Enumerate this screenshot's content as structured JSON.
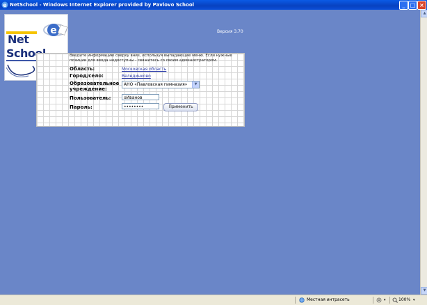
{
  "window": {
    "title": "NetSchool - Windows Internet Explorer provided by Pavlovo School",
    "buttons": {
      "minimize": "_",
      "maximize": "□",
      "close": "×"
    }
  },
  "header": {
    "version": "Версия 3.70",
    "logo": {
      "line1": "Net",
      "line2": "School"
    }
  },
  "login": {
    "intro": "Введите информацию сверху вниз, используя выпадающие меню. Если нужные позиции для ввода недоступны - свяжитесь со своим администратором.",
    "region_label": "Область:",
    "region_value": "Московская область",
    "city_label": "Город/село:",
    "city_value": "Велединково",
    "school_label": "Образовательное учреждение:",
    "school_value": "АНО «Павловская гимназия»",
    "user_label": "Пользователь:",
    "user_value": "оИванов",
    "password_label": "Пароль:",
    "password_value": "••••••••",
    "apply_label": "Применить"
  },
  "statusbar": {
    "zone": "Местная интрасеть",
    "zoom": "100%",
    "icons": [
      "globe-icon",
      "zoom-icon"
    ]
  },
  "colors": {
    "page_bg": "#6a86c8",
    "titlebar": "#0a4fd8",
    "link": "#2a3aa8"
  }
}
